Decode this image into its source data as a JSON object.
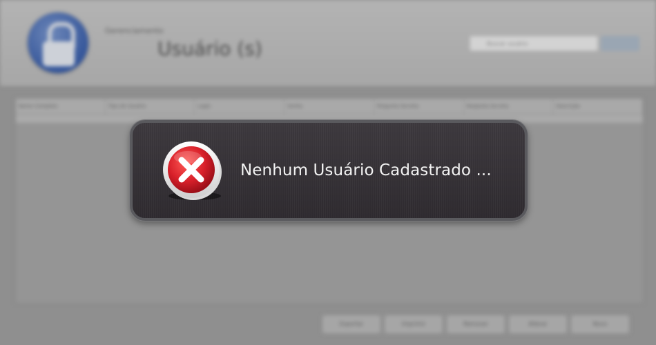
{
  "header": {
    "subtitle": "Gerenciamento",
    "title": "Usuário (s)",
    "search_placeholder": "Buscar usuário"
  },
  "grid": {
    "columns": [
      "Nome Completo",
      "Tipo de Usuário",
      "Login",
      "Senha",
      "Pergunta Secreta",
      "Resposta Secreta",
      "Descrição"
    ]
  },
  "footer_buttons": [
    "Exportar",
    "Imprimir",
    "Remover",
    "Alterar",
    "Novo"
  ],
  "dialog": {
    "message": "Nenhum Usuário Cadastrado ...",
    "icon": "error-x-icon",
    "colors": {
      "background": "#35313a",
      "border": "#5a5a5e",
      "icon_red": "#d8202a"
    }
  }
}
